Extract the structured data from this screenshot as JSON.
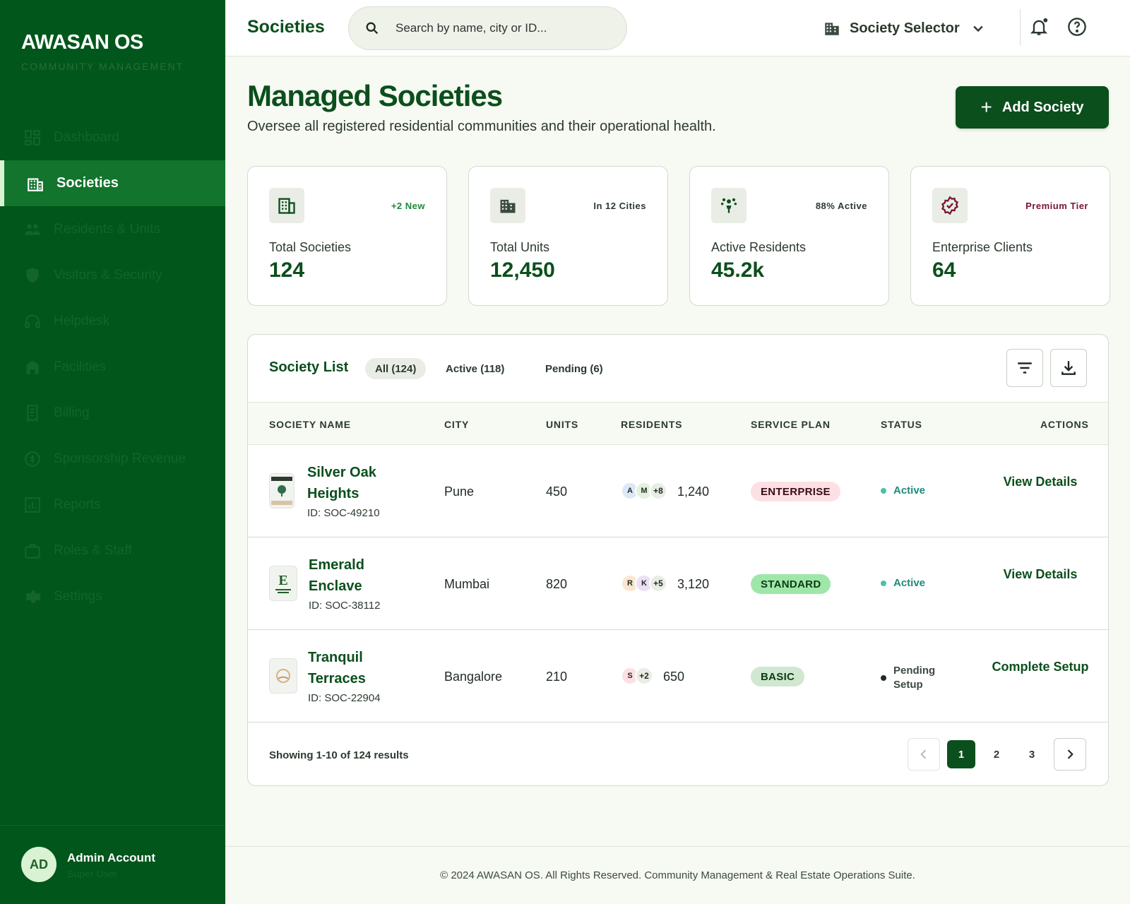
{
  "sidebar": {
    "brand": "AWASAN OS",
    "brand_sub": "COMMUNITY MANAGEMENT",
    "items": [
      {
        "label": "Dashboard",
        "icon": "dashboard-icon"
      },
      {
        "label": "Societies",
        "icon": "building-icon",
        "active": true
      },
      {
        "label": "Residents & Units",
        "icon": "people-icon"
      },
      {
        "label": "Visitors & Security",
        "icon": "shield-icon"
      },
      {
        "label": "Helpdesk",
        "icon": "headset-icon"
      },
      {
        "label": "Facilities",
        "icon": "facility-icon"
      },
      {
        "label": "Billing",
        "icon": "receipt-icon"
      },
      {
        "label": "Sponsorship Revenue",
        "icon": "coin-icon"
      },
      {
        "label": "Reports",
        "icon": "chart-icon"
      },
      {
        "label": "Roles & Staff",
        "icon": "badge-icon"
      },
      {
        "label": "Settings",
        "icon": "gear-icon"
      }
    ],
    "account": {
      "initials": "AD",
      "name": "Admin Account",
      "role": "Super User"
    }
  },
  "topbar": {
    "title": "Societies",
    "search_placeholder": "Search by name, city or ID...",
    "selector_label": "Society Selector"
  },
  "page": {
    "title": "Managed Societies",
    "subtitle": "Oversee all registered residential communities and their operational health.",
    "add_label": "Add Society"
  },
  "stats": [
    {
      "label": "Total Societies",
      "value": "124",
      "badge": "+2 New",
      "badge_color": "#1e8a3a",
      "icon": "building-icon"
    },
    {
      "label": "Total Units",
      "value": "12,450",
      "badge": "In 12 Cities",
      "badge_color": "#2c3a2f",
      "icon": "apartment-icon"
    },
    {
      "label": "Active Residents",
      "value": "45.2k",
      "badge": "88% Active",
      "badge_color": "#2c3a2f",
      "icon": "community-icon"
    },
    {
      "label": "Enterprise Clients",
      "value": "64",
      "badge": "Premium Tier",
      "badge_color": "#7a1530",
      "icon": "verified-badge-icon"
    }
  ],
  "list": {
    "title": "Society List",
    "tabs": [
      "All (124)",
      "Active (118)",
      "Pending (6)"
    ],
    "columns": [
      "SOCIETY NAME",
      "CITY",
      "UNITS",
      "RESIDENTS",
      "SERVICE PLAN",
      "STATUS",
      "ACTIONS"
    ],
    "rows": [
      {
        "name": "Silver Oak Heights",
        "id": "ID: SOC-49210",
        "city": "Pune",
        "units": "450",
        "avatars": [
          "A",
          "M"
        ],
        "more": "+8",
        "residents": "1,240",
        "plan": "ENTERPRISE",
        "plan_bg": "#fde0e4",
        "plan_fg": "#3a0d16",
        "status": "Active",
        "status_color": "#1e8a7a",
        "action": "View Details"
      },
      {
        "name": "Emerald Enclave",
        "id": "ID: SOC-38112",
        "city": "Mumbai",
        "units": "820",
        "avatars": [
          "R",
          "K"
        ],
        "more": "+5",
        "residents": "3,120",
        "plan": "STANDARD",
        "plan_bg": "#9ee7a8",
        "plan_fg": "#0d3a16",
        "status": "Active",
        "status_color": "#1e8a7a",
        "action": "View Details"
      },
      {
        "name": "Tranquil Terraces",
        "id": "ID: SOC-22904",
        "city": "Bangalore",
        "units": "210",
        "avatars": [
          "S"
        ],
        "more": "+2",
        "residents": "650",
        "plan": "BASIC",
        "plan_bg": "#cfe8cf",
        "plan_fg": "#0d3a16",
        "status": "Pending Setup",
        "status_color": "#3b4a3f",
        "action": "Complete Setup"
      }
    ],
    "results": "Showing 1-10 of 124 results",
    "pages": [
      "1",
      "2",
      "3"
    ]
  },
  "footer": "© 2024 AWASAN OS. All Rights Reserved. Community Management & Real Estate Operations Suite."
}
